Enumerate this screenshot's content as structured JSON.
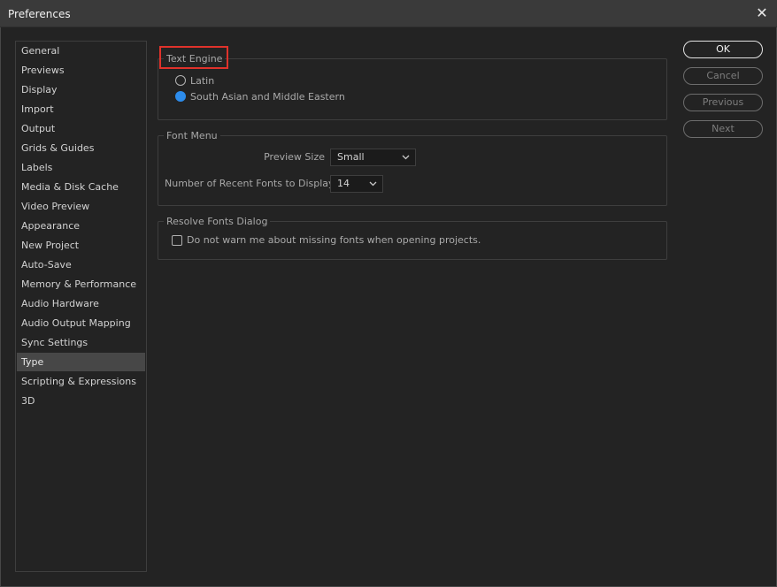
{
  "window": {
    "title": "Preferences",
    "close_icon": "close-icon"
  },
  "sidebar": {
    "items": [
      {
        "label": "General"
      },
      {
        "label": "Previews"
      },
      {
        "label": "Display"
      },
      {
        "label": "Import"
      },
      {
        "label": "Output"
      },
      {
        "label": "Grids & Guides"
      },
      {
        "label": "Labels"
      },
      {
        "label": "Media & Disk Cache"
      },
      {
        "label": "Video Preview"
      },
      {
        "label": "Appearance"
      },
      {
        "label": "New Project"
      },
      {
        "label": "Auto-Save"
      },
      {
        "label": "Memory & Performance"
      },
      {
        "label": "Audio Hardware"
      },
      {
        "label": "Audio Output Mapping"
      },
      {
        "label": "Sync Settings"
      },
      {
        "label": "Type"
      },
      {
        "label": "Scripting & Expressions"
      },
      {
        "label": "3D"
      }
    ],
    "selected": "Type"
  },
  "text_engine": {
    "label": "Text Engine",
    "options": [
      {
        "label": "Latin",
        "selected": false
      },
      {
        "label": "South Asian and Middle Eastern",
        "selected": true
      }
    ]
  },
  "font_menu": {
    "label": "Font Menu",
    "preview_size_label": "Preview Size",
    "preview_size_value": "Small",
    "recent_fonts_label": "Number of Recent Fonts to Display",
    "recent_fonts_value": "14"
  },
  "resolve_fonts": {
    "label": "Resolve Fonts Dialog",
    "checkbox_label": "Do not warn me about missing fonts when opening projects.",
    "checked": false
  },
  "buttons": {
    "ok": "OK",
    "cancel": "Cancel",
    "previous": "Previous",
    "next": "Next"
  },
  "colors": {
    "accent_radio": "#2d8ceb",
    "highlight_box": "#e0322b",
    "background": "#232323",
    "selected_item": "#474747"
  }
}
